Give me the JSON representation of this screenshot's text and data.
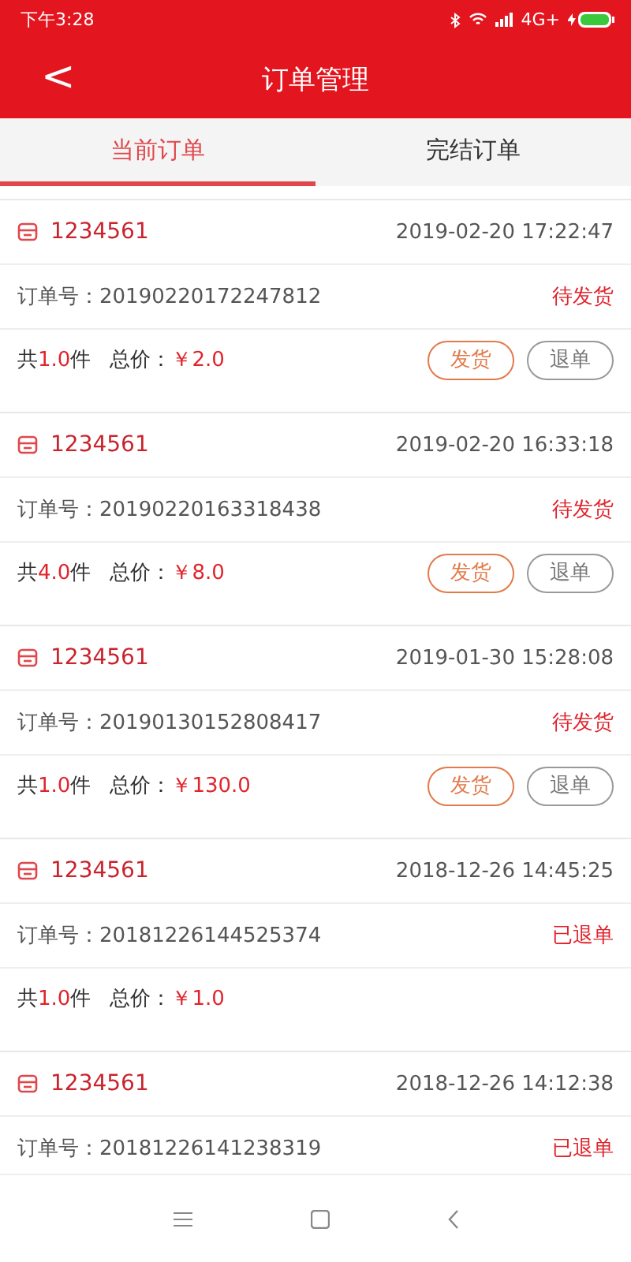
{
  "status_bar": {
    "time": "下午3:28",
    "network": "4G+"
  },
  "header": {
    "back": "<",
    "title": "订单管理"
  },
  "tabs": [
    {
      "label": "当前订单",
      "selected": true
    },
    {
      "label": "完结订单",
      "selected": false
    }
  ],
  "orders": [
    {
      "shop": "1234561",
      "time": "2019-02-20 17:22:47",
      "order_no": "订单号：20190220172247812",
      "status": "待发货",
      "summary": {
        "count_prefix": "共",
        "count": "1.0",
        "count_suffix": "件",
        "price_label": "总价：",
        "price": "￥2.0"
      },
      "actions": [
        {
          "label": "发货",
          "kind": "ship"
        },
        {
          "label": "退单",
          "kind": "cancel"
        }
      ]
    },
    {
      "shop": "1234561",
      "time": "2019-02-20 16:33:18",
      "order_no": "订单号：20190220163318438",
      "status": "待发货",
      "summary": {
        "count_prefix": "共",
        "count": "4.0",
        "count_suffix": "件",
        "price_label": "总价：",
        "price": "￥8.0"
      },
      "actions": [
        {
          "label": "发货",
          "kind": "ship"
        },
        {
          "label": "退单",
          "kind": "cancel"
        }
      ]
    },
    {
      "shop": "1234561",
      "time": "2019-01-30 15:28:08",
      "order_no": "订单号：20190130152808417",
      "status": "待发货",
      "summary": {
        "count_prefix": "共",
        "count": "1.0",
        "count_suffix": "件",
        "price_label": "总价：",
        "price": "￥130.0"
      },
      "actions": [
        {
          "label": "发货",
          "kind": "ship"
        },
        {
          "label": "退单",
          "kind": "cancel"
        }
      ]
    },
    {
      "shop": "1234561",
      "time": "2018-12-26 14:45:25",
      "order_no": "订单号：20181226144525374",
      "status": "已退单",
      "summary": {
        "count_prefix": "共",
        "count": "1.0",
        "count_suffix": "件",
        "price_label": "总价：",
        "price": "￥1.0"
      }
    },
    {
      "shop": "1234561",
      "time": "2018-12-26 14:12:38",
      "order_no": "订单号：20181226141238319",
      "status": "已退单"
    }
  ]
}
